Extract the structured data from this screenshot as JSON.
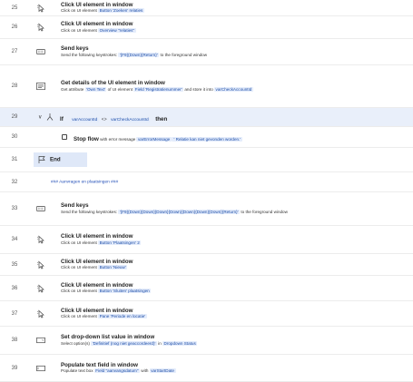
{
  "flow": {
    "rows": [
      {
        "number": "25",
        "type": "action",
        "icon": "click-icon",
        "title": "Click UI element in window",
        "desc": [
          {
            "t": "Click on UI element "
          },
          {
            "t": "Button 'Zoeken' relaties",
            "chip": true
          }
        ]
      },
      {
        "number": "26",
        "type": "action",
        "icon": "click-icon",
        "title": "Click UI element in window",
        "desc": [
          {
            "t": "Click on UI element "
          },
          {
            "t": "Overview \"relaties\"",
            "chip": true
          }
        ]
      },
      {
        "number": "27",
        "type": "action",
        "icon": "keyboard-icon",
        "title": "Send keys",
        "desc": [
          {
            "t": "Send the following keystrokes: "
          },
          {
            "t": "'{F9}{Down}{Return}'",
            "chip": true
          },
          {
            "t": " to the foreground window"
          }
        ]
      },
      {
        "number": "28",
        "type": "action",
        "icon": "details-icon",
        "title": "Get details of the UI element in window",
        "desc": [
          {
            "t": "Get attribute "
          },
          {
            "t": "'Own Text'",
            "chip": true
          },
          {
            "t": " of UI element "
          },
          {
            "t": "Field 'Registratienummer'",
            "chip": true
          },
          {
            "t": " and store it into "
          },
          {
            "t": "varCheckAccountId",
            "chip": true
          }
        ]
      },
      {
        "number": "29",
        "type": "if",
        "icon": "if-icon",
        "keyword": "If",
        "left": "varAccountId",
        "op": "<>",
        "right": "varCheckAccountId",
        "then": "then"
      },
      {
        "number": "30",
        "type": "stop",
        "icon": "stop-icon",
        "title": "Stop flow",
        "desc": [
          {
            "t": " with error message "
          },
          {
            "t": "varErrorMessage",
            "chip": true
          },
          {
            "t": " ' Relatie kan niet gevonden worden.'",
            "chip": true
          }
        ]
      },
      {
        "number": "31",
        "type": "end",
        "icon": "flag-icon",
        "keyword": "End"
      },
      {
        "number": "32",
        "type": "comment",
        "text": "### Aanvragen en plaatsingen ###"
      },
      {
        "number": "33",
        "type": "action",
        "icon": "keyboard-icon",
        "title": "Send keys",
        "desc": [
          {
            "t": "Send the following keystrokes: "
          },
          {
            "t": "'{F9}{Down}{Down}{Down}{Down}{Down}{Down}{Down}{Return}'",
            "chip": true
          },
          {
            "t": " to the foreground window"
          }
        ]
      },
      {
        "number": "34",
        "type": "action",
        "icon": "click-icon",
        "title": "Click UI element in window",
        "desc": [
          {
            "t": "Click on UI element "
          },
          {
            "t": "Button 'Plaatsingen' 2",
            "chip": true
          }
        ]
      },
      {
        "number": "35",
        "type": "action",
        "icon": "click-icon",
        "title": "Click UI element in window",
        "desc": [
          {
            "t": "Click on UI element "
          },
          {
            "t": "Button 'Nieuw'",
            "chip": true
          }
        ]
      },
      {
        "number": "36",
        "type": "action",
        "icon": "click-icon",
        "title": "Click UI element in window",
        "desc": [
          {
            "t": "Click on UI element "
          },
          {
            "t": "Button 'Sluiten' plaatsingen",
            "chip": true
          }
        ]
      },
      {
        "number": "37",
        "type": "action",
        "icon": "click-icon",
        "title": "Click UI element in window",
        "desc": [
          {
            "t": "Click on UI element "
          },
          {
            "t": "Pane 'Periode en locatie'",
            "chip": true
          }
        ]
      },
      {
        "number": "38",
        "type": "action",
        "icon": "dropdown-icon",
        "title": "Set drop-down list value in window",
        "desc": [
          {
            "t": "Select option(s) "
          },
          {
            "t": "'Definitief (nog niet geaccordeerd)'",
            "chip": true
          },
          {
            "t": " in "
          },
          {
            "t": "Dropdown Status",
            "chip": true
          }
        ]
      },
      {
        "number": "39",
        "type": "action",
        "icon": "textfield-icon",
        "title": "Populate text field in window",
        "desc": [
          {
            "t": "Populate text box "
          },
          {
            "t": "Field \"aanvangsdatum\"",
            "chip": true
          },
          {
            "t": " with "
          },
          {
            "t": "varStartDate",
            "chip": true
          }
        ]
      }
    ]
  }
}
